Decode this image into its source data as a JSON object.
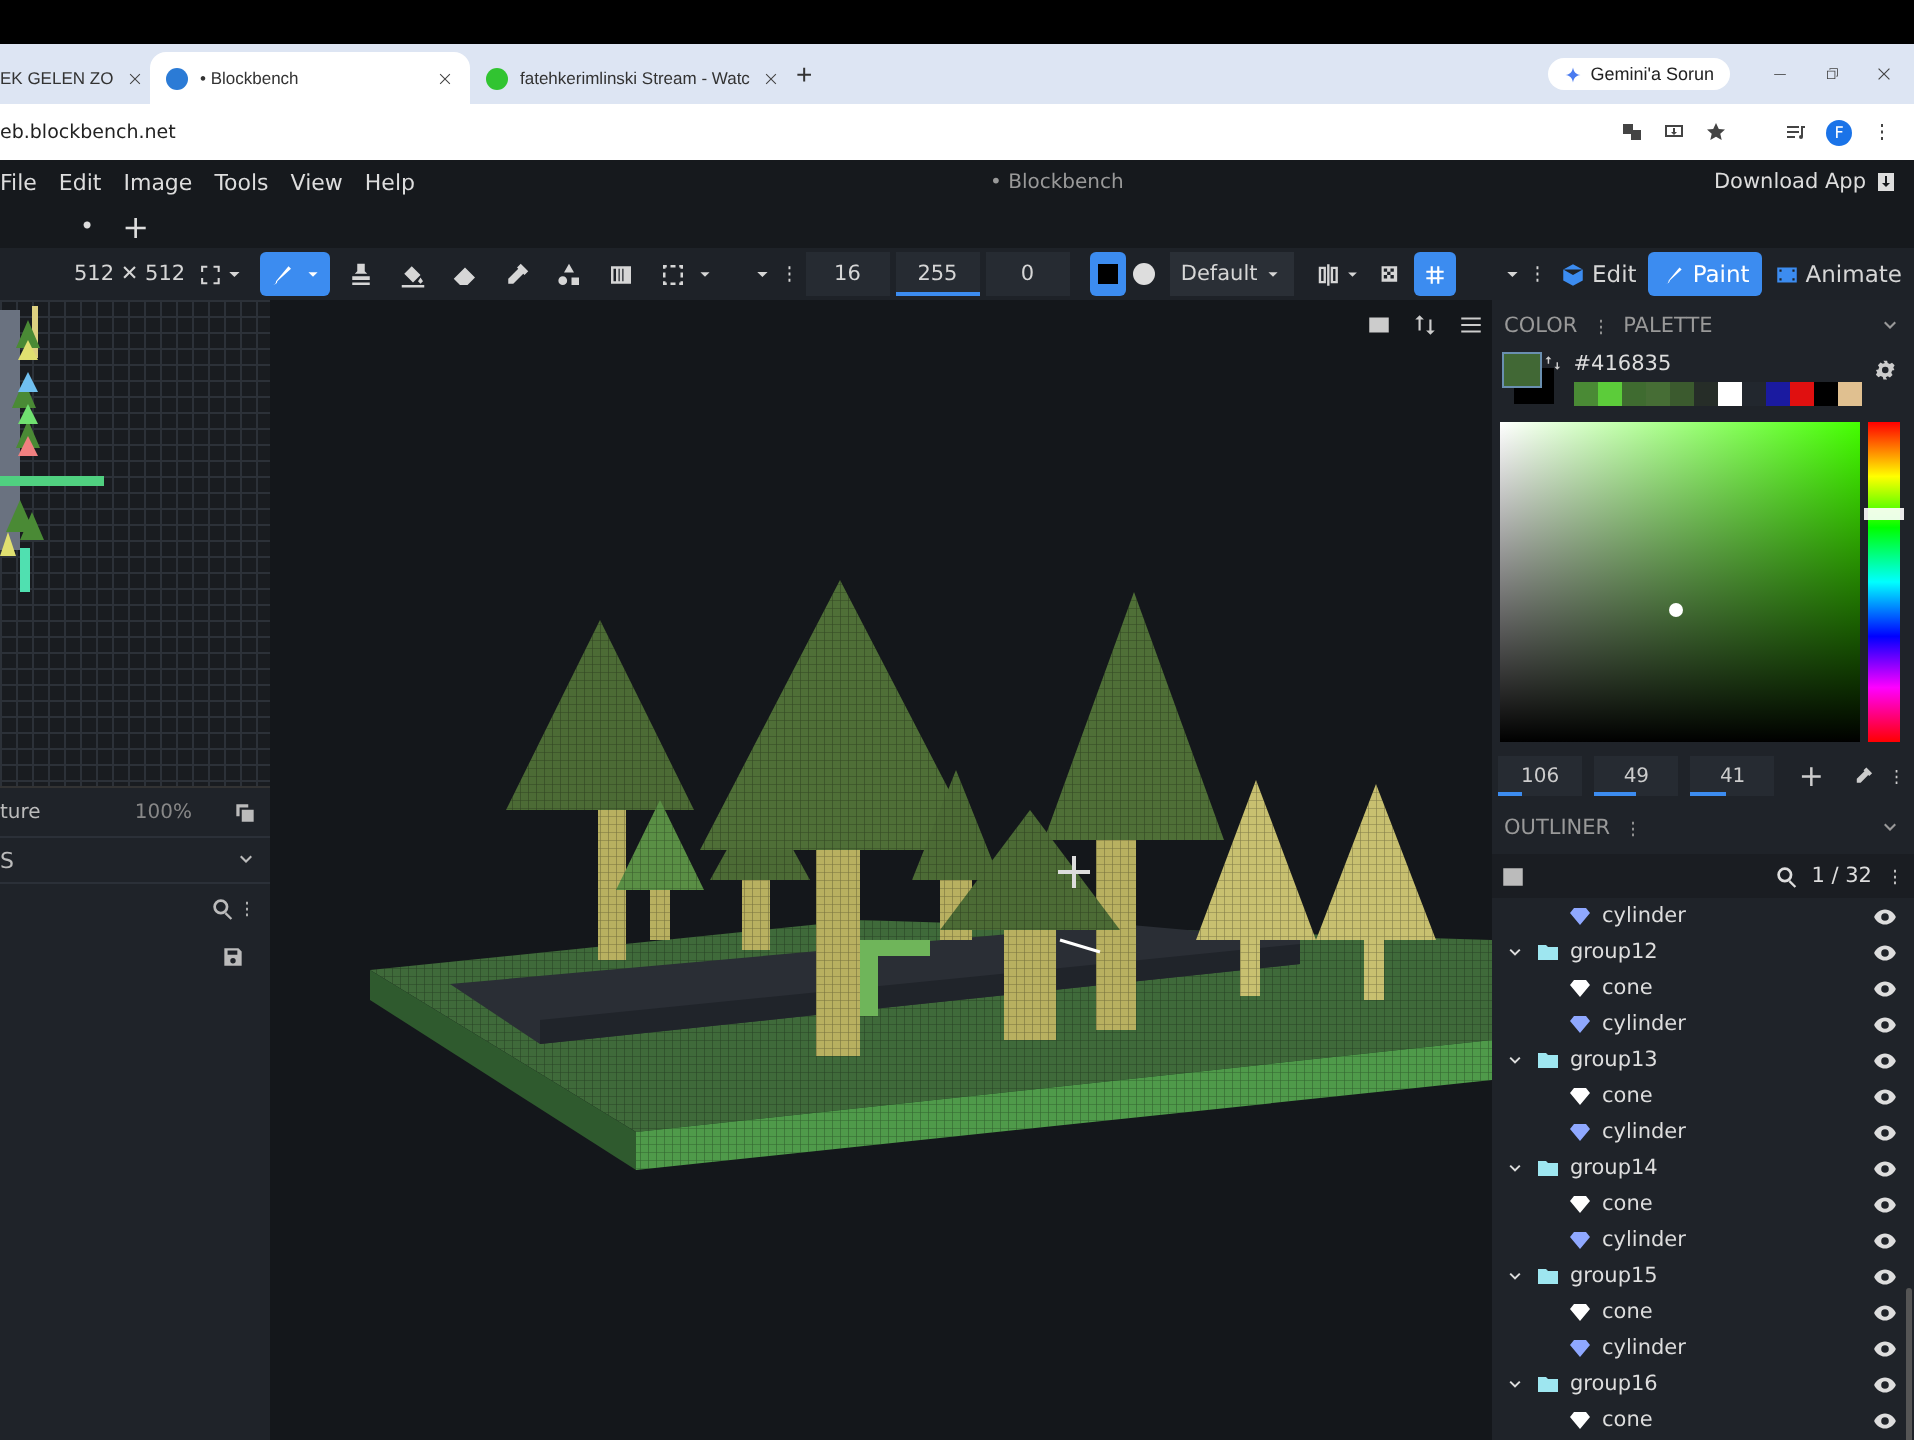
{
  "browser": {
    "tabs": [
      {
        "title": "EK GELEN ZO",
        "selected": false
      },
      {
        "title": "• Blockbench",
        "selected": true
      },
      {
        "title": "fatehkerimlinski Stream - Watc",
        "selected": false
      }
    ],
    "new_tab": "+",
    "assistant_button": "Gemini'a Sorun",
    "address": "eb.blockbench.net",
    "profile_initial": "F"
  },
  "menu_bar": {
    "items": [
      "File",
      "Edit",
      "Image",
      "Tools",
      "View",
      "Help"
    ],
    "title": "• Blockbench",
    "download_button": "Download App"
  },
  "project_tabs": {
    "unsaved_mark": "•",
    "add": "+"
  },
  "toolbar": {
    "texture_size": "512 ✕ 512",
    "tools": [
      {
        "kind": "brush",
        "selected": true
      },
      {
        "kind": "stamp",
        "selected": false
      },
      {
        "kind": "fill",
        "selected": false
      },
      {
        "kind": "eraser",
        "selected": false
      },
      {
        "kind": "eyedropper",
        "selected": false
      },
      {
        "kind": "shapes",
        "selected": false
      },
      {
        "kind": "gradient",
        "selected": false
      },
      {
        "kind": "selection",
        "selected": false
      }
    ],
    "fields": [
      {
        "value": "16"
      },
      {
        "value": "255",
        "level": 1
      },
      {
        "value": "0"
      }
    ],
    "brush_shapes": [
      {
        "kind": "square",
        "selected": true
      },
      {
        "kind": "round",
        "selected": false
      }
    ],
    "blend_mode": "Default",
    "grid_selected": true,
    "modes": [
      {
        "label": "Edit",
        "selected": false
      },
      {
        "label": "Paint",
        "selected": true
      },
      {
        "label": "Animate",
        "selected": false
      }
    ]
  },
  "uv_panel": {
    "texture_label": "ture",
    "zoom": "100%"
  },
  "textures_panel": {
    "title": "S"
  },
  "color_panel": {
    "tabs": [
      "COLOR",
      "PALETTE"
    ],
    "hex": "#416835",
    "hue_slider": {
      "level": 0.71
    },
    "palette": [
      {
        "color": "#4a8a35"
      },
      {
        "color": "#5ccc3a"
      },
      {
        "color": "#3f6b30"
      },
      {
        "color": "#466d35"
      },
      {
        "color": "#3b5a2e"
      },
      {
        "color": "#262d28"
      },
      {
        "color": "#ffffff"
      },
      {
        "color": "#22272e"
      },
      {
        "color": "#1a1aa0"
      },
      {
        "color": "#e01010"
      },
      {
        "color": "#000000"
      },
      {
        "color": "#e0c090"
      }
    ],
    "inputs": [
      {
        "value": "106",
        "level": 0.29
      },
      {
        "value": "49",
        "level": 0.49
      },
      {
        "value": "41",
        "level": 0.41
      }
    ],
    "add": "+"
  },
  "outliner": {
    "title": "OUTLINER",
    "count": "1 / 32",
    "items": [
      {
        "kind": "mesh",
        "name": "cylinder",
        "color": "#8fa8ff",
        "visible": true
      },
      {
        "kind": "group",
        "name": "group12",
        "expanded": true,
        "visible": true,
        "children": [
          {
            "kind": "mesh",
            "name": "cone",
            "color": "#ffffff",
            "visible": true
          },
          {
            "kind": "mesh",
            "name": "cylinder",
            "color": "#8fa8ff",
            "visible": true
          }
        ]
      },
      {
        "kind": "group",
        "name": "group13",
        "expanded": true,
        "visible": true,
        "children": [
          {
            "kind": "mesh",
            "name": "cone",
            "color": "#ffffff",
            "visible": true
          },
          {
            "kind": "mesh",
            "name": "cylinder",
            "color": "#8fa8ff",
            "visible": true
          }
        ]
      },
      {
        "kind": "group",
        "name": "group14",
        "expanded": true,
        "visible": true,
        "children": [
          {
            "kind": "mesh",
            "name": "cone",
            "color": "#ffffff",
            "visible": true
          },
          {
            "kind": "mesh",
            "name": "cylinder",
            "color": "#8fa8ff",
            "visible": true
          }
        ]
      },
      {
        "kind": "group",
        "name": "group15",
        "expanded": true,
        "visible": true,
        "children": [
          {
            "kind": "mesh",
            "name": "cone",
            "color": "#ffffff",
            "visible": true
          },
          {
            "kind": "mesh",
            "name": "cylinder",
            "color": "#8fa8ff",
            "visible": true
          }
        ]
      },
      {
        "kind": "group",
        "name": "group16",
        "expanded": true,
        "visible": true,
        "children": [
          {
            "kind": "mesh",
            "name": "cone",
            "color": "#ffffff",
            "visible": true
          }
        ]
      }
    ]
  }
}
